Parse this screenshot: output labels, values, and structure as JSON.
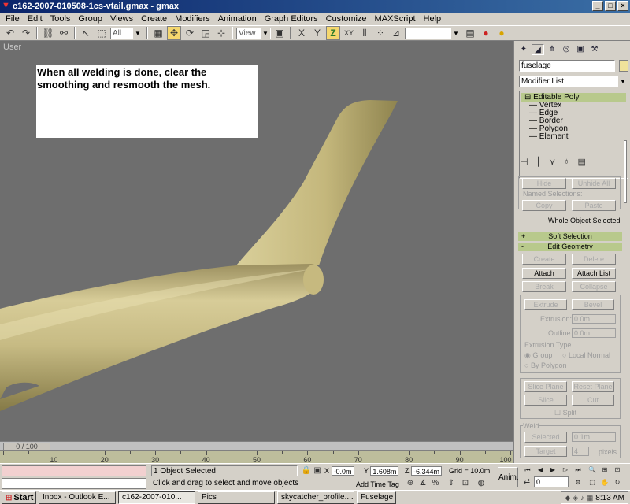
{
  "window": {
    "title": "c162-2007-010508-1cs-vtail.gmax - gmax",
    "buttons": [
      "_",
      "□",
      "×"
    ]
  },
  "menu": [
    "File",
    "Edit",
    "Tools",
    "Group",
    "Views",
    "Create",
    "Modifiers",
    "Animation",
    "Graph Editors",
    "Customize",
    "MAXScript",
    "Help"
  ],
  "toolbar": {
    "filter": "All",
    "ref_coord": "View",
    "named_sel": ""
  },
  "viewport": {
    "label": "User",
    "note": "When all welding is done, clear the smoothing and resmooth the mesh."
  },
  "command_panel": {
    "object_name": "fuselage",
    "modifier_list": "Modifier List",
    "stack": {
      "head": "Editable Poly",
      "subs": [
        "Vertex",
        "Edge",
        "Border",
        "Polygon",
        "Element"
      ]
    },
    "selection": {
      "hide": "Hide",
      "unhide_all": "Unhide All",
      "named_selections": "Named Selections:",
      "copy": "Copy",
      "paste": "Paste",
      "whole_object": "Whole Object Selected"
    },
    "soft_selection": "Soft Selection",
    "edit_geometry": {
      "title": "Edit Geometry",
      "create": "Create",
      "delete": "Delete",
      "attach": "Attach",
      "attach_list": "Attach List",
      "break": "Break",
      "collapse": "Collapse",
      "extrude": "Extrude",
      "bevel": "Bevel",
      "extrusion_label": "Extrusion:",
      "extrusion_value": "0.0m",
      "outline_label": "Outline:",
      "outline_value": "0.0m",
      "extrusion_type": "Extrusion Type",
      "group": "Group",
      "local_normal": "Local Normal",
      "by_polygon": "By Polygon",
      "slice_plane": "Slice Plane",
      "reset_plane": "Reset Plane",
      "slice": "Slice",
      "cut": "Cut",
      "split": "Split",
      "weld": "Weld",
      "selected": "Selected",
      "selected_value": "0.1m",
      "target": "Target",
      "target_value": "4",
      "pixels": "pixels"
    }
  },
  "timeline": {
    "thumb": "0 / 100",
    "ticks": [
      {
        "v": 10,
        "label": "10"
      },
      {
        "v": 20,
        "label": "20"
      },
      {
        "v": 30,
        "label": "30"
      },
      {
        "v": 40,
        "label": "40"
      },
      {
        "v": 50,
        "label": "50"
      },
      {
        "v": 60,
        "label": "60"
      },
      {
        "v": 70,
        "label": "70"
      },
      {
        "v": 80,
        "label": "80"
      },
      {
        "v": 90,
        "label": "90"
      },
      {
        "v": 100,
        "label": "100"
      }
    ]
  },
  "status": {
    "selected": "1 Object Selected",
    "prompt": "Click and drag to select and move objects",
    "x_label": "X",
    "x": "-0.0m",
    "y_label": "Y",
    "y": "1.608m",
    "z_label": "Z",
    "z": "-6.344m",
    "grid": "Grid = 10.0m",
    "add_time_tag": "Add Time Tag",
    "anim": "Anim.",
    "frame": "0"
  },
  "taskbar": {
    "start": "Start",
    "tasks": [
      "Inbox - Outlook E...",
      "c162-2007-010...",
      "Pics",
      "skycatcher_profile....",
      "Fuselage - Paint"
    ],
    "clock": "8:13 AM"
  },
  "colors": {
    "viewport_bg": "#6e6e6e",
    "model": "#c9bd86",
    "rollout_bar": "#b8c98c"
  }
}
